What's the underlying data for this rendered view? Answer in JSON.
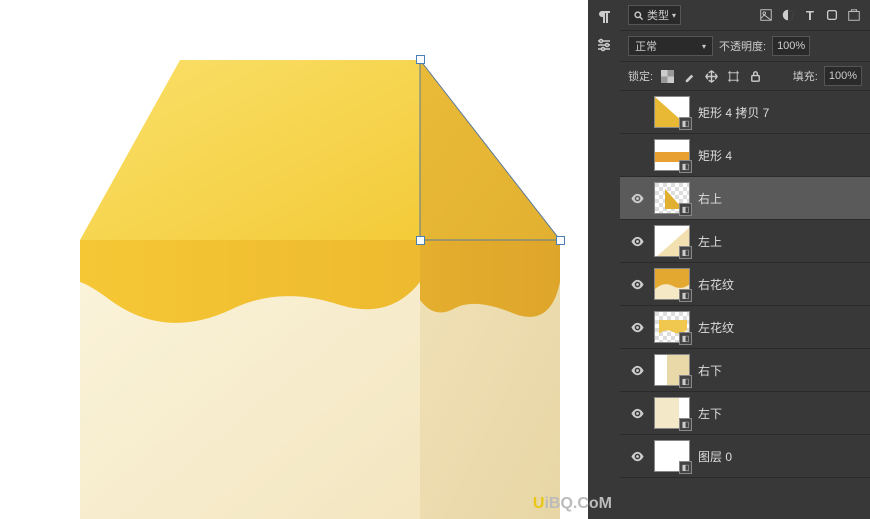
{
  "tools": {
    "paragraph_icon": "paragraph",
    "adjustments_icon": "adjustments"
  },
  "filter": {
    "search_placeholder": "类型",
    "icons": [
      "image",
      "adjustment",
      "text",
      "shape",
      "smart"
    ]
  },
  "blend": {
    "mode": "正常",
    "opacity_label": "不透明度:",
    "opacity_value": "100%"
  },
  "lock": {
    "label": "锁定:",
    "fill_label": "填充:",
    "fill_value": "100%"
  },
  "layers": [
    {
      "name": "矩形 4 拷贝 7",
      "visible": false,
      "selected": false,
      "thumb_style": "diag-split"
    },
    {
      "name": "矩形 4",
      "visible": false,
      "selected": false,
      "thumb_style": "orange-bar"
    },
    {
      "name": "右上",
      "visible": true,
      "selected": true,
      "thumb_style": "triangle"
    },
    {
      "name": "左上",
      "visible": true,
      "selected": false,
      "thumb_style": "diag-light"
    },
    {
      "name": "右花纹",
      "visible": true,
      "selected": false,
      "thumb_style": "wave-dark"
    },
    {
      "name": "左花纹",
      "visible": true,
      "selected": false,
      "thumb_style": "wave-light"
    },
    {
      "name": "右下",
      "visible": true,
      "selected": false,
      "thumb_style": "beige-right"
    },
    {
      "name": "左下",
      "visible": true,
      "selected": false,
      "thumb_style": "beige-left"
    },
    {
      "name": "图层 0",
      "visible": true,
      "selected": false,
      "thumb_style": "white"
    }
  ],
  "watermark": {
    "first": "U",
    "rest": "iBQ.CoM"
  }
}
